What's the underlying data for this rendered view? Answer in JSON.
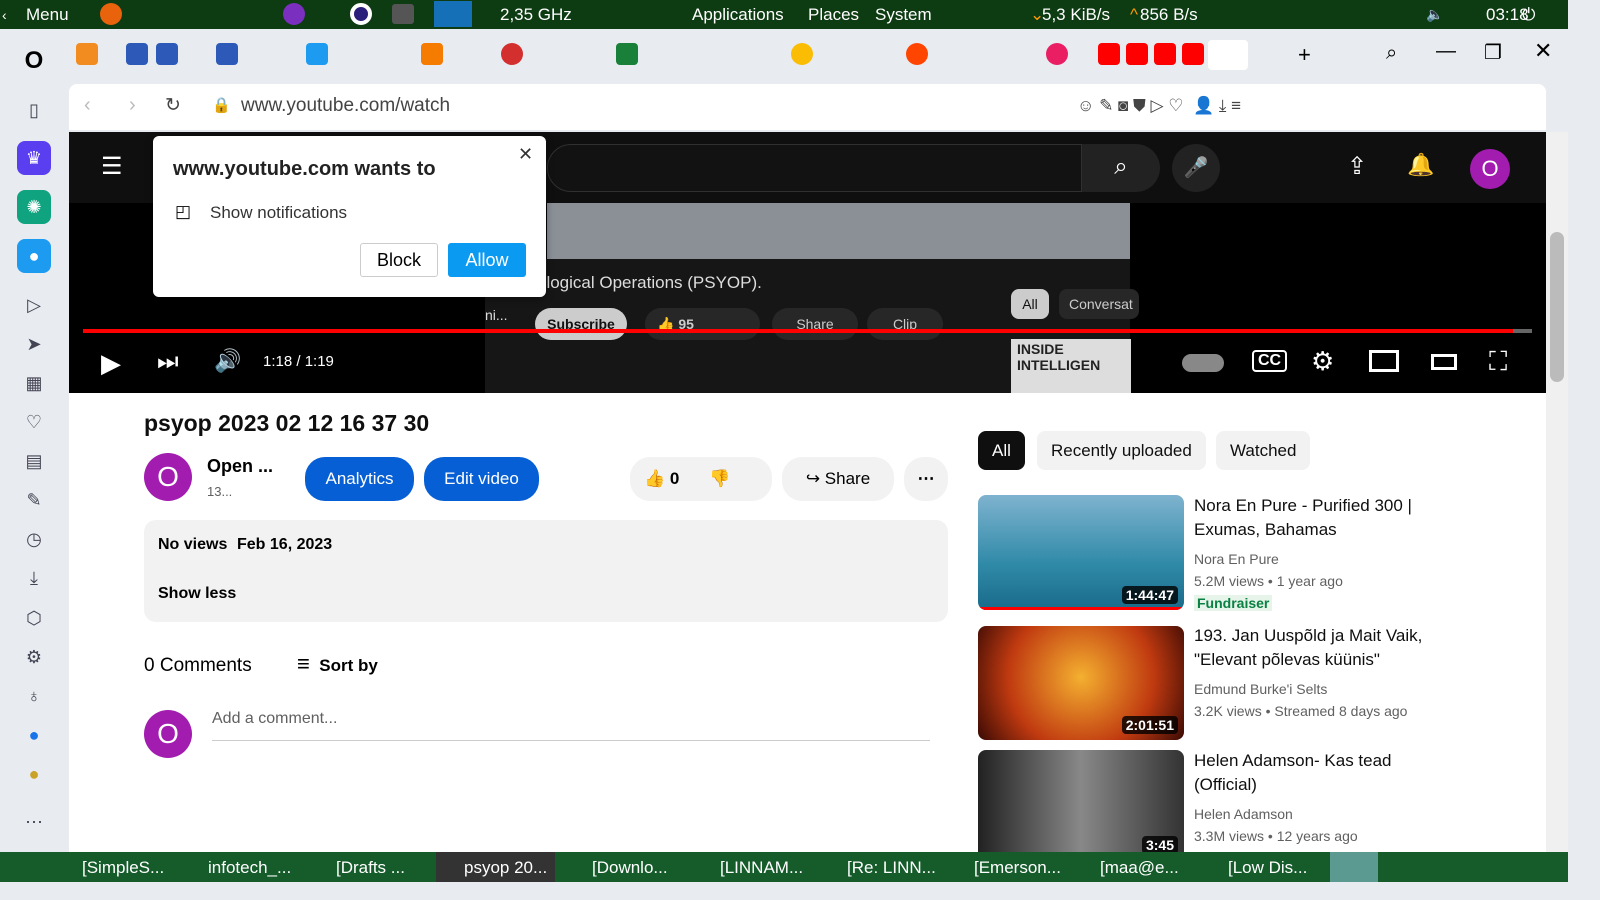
{
  "system_panel": {
    "menu": "Menu",
    "cpu": "2,35 GHz",
    "applications": "Applications",
    "places": "Places",
    "system": "System",
    "net_down": "5,3 KiB/s",
    "net_up": "856 B/s",
    "clock": "03:18"
  },
  "browser": {
    "url": "www.youtube.com/watch"
  },
  "permission_popup": {
    "title": "www.youtube.com wants to",
    "permission": "Show notifications",
    "block": "Block",
    "allow": "Allow"
  },
  "player": {
    "time": "1:18 / 1:19",
    "progress": 0.987,
    "embedded_caption": "ological Operations (PSYOP).",
    "embedded_channel": "ni...",
    "embedded_subscribe": "Subscribe",
    "embedded_likes": "95",
    "embedded_share": "Share",
    "embedded_clip": "Clip",
    "embedded_chip_all": "All",
    "embedded_chip_conv": "Conversat",
    "embedded_thumb": "INSIDE INTELLIGEN"
  },
  "video": {
    "title": "psyop 2023 02 12 16 37 30",
    "channel": "Open ...",
    "subs": "13...",
    "avatar": "O",
    "analytics": "Analytics",
    "edit": "Edit video",
    "likes": "0",
    "share": "Share",
    "views": "No views",
    "date": "Feb 16, 2023",
    "show_less": "Show less"
  },
  "comments": {
    "count": "0 Comments",
    "sort": "Sort by",
    "placeholder": "Add a comment...",
    "avatar": "O"
  },
  "chips": [
    "All",
    "Recently uploaded",
    "Watched"
  ],
  "related": [
    {
      "title": "Nora En Pure - Purified 300 | Exumas, Bahamas",
      "channel": "Nora En Pure",
      "views": "5.2M views",
      "age": "1 year ago",
      "badge": "Fundraiser",
      "duration": "1:44:47"
    },
    {
      "title": "193. Jan Uuspõld ja Mait Vaik, \"Elevant põlevas küünis\"",
      "channel": "Edmund Burke'i Selts",
      "views": "3.2K views",
      "age": "Streamed 8 days ago",
      "duration": "2:01:51"
    },
    {
      "title": "Helen Adamson- Kas tead (Official)",
      "channel": "Helen Adamson",
      "views": "3.3M views",
      "age": "12 years ago",
      "duration": "3:45"
    }
  ],
  "taskbar": [
    "[SimpleS...",
    "infotech_...",
    "[Drafts ...",
    "psyop 20...",
    "[Downlo...",
    "[LINNAM...",
    "[Re: LINN...",
    "[Emerson...",
    "[maa@e...",
    "[Low Dis..."
  ],
  "colors": {
    "accent": "#065fd4",
    "progress": "#ff0000",
    "panel": "#0d3b12",
    "taskbar": "#165c2b"
  }
}
